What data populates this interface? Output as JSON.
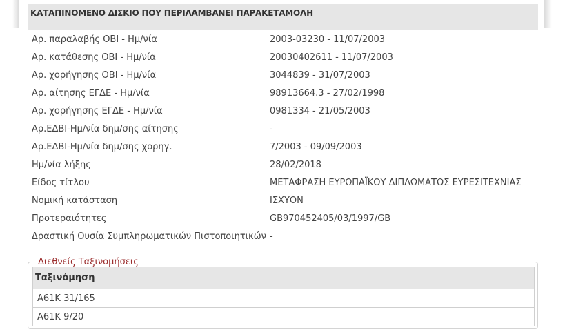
{
  "title": "ΚΑΤΑΠΙΝΟΜΕΝΟ ΔΙΣΚΙΟ ΠΟΥ ΠΕΡΙΛΑΜΒΑΝΕΙ ΠΑΡΑΚΕΤΑΜΟΛΗ",
  "details": [
    {
      "label": "Αρ. παραλαβής ΟΒΙ - Ημ/νία",
      "value": "2003-03230 - 11/07/2003"
    },
    {
      "label": "Αρ. κατάθεσης ΟΒΙ - Ημ/νία",
      "value": "20030402611 - 11/07/2003"
    },
    {
      "label": "Αρ. χορήγησης ΟΒΙ - Ημ/νία",
      "value": "3044839 - 31/07/2003"
    },
    {
      "label": "Αρ. αίτησης ΕΓΔΕ - Ημ/νία",
      "value": "98913664.3 - 27/02/1998"
    },
    {
      "label": "Αρ. χορήγησης ΕΓΔΕ - Ημ/νία",
      "value": "0981334 - 21/05/2003"
    },
    {
      "label": "Αρ.ΕΔΒΙ-Ημ/νία δημ/σης αίτησης",
      "value": "-"
    },
    {
      "label": "Αρ.ΕΔΒΙ-Ημ/νία δημ/σης χορηγ.",
      "value": "7/2003 - 09/09/2003"
    },
    {
      "label": "Ημ/νία λήξης",
      "value": "28/02/2018"
    },
    {
      "label": "Είδος τίτλου",
      "value": "ΜΕΤΑΦΡΑΣΗ ΕΥΡΩΠΑΪΚΟΥ ΔΙΠΛΩΜΑΤΟΣ ΕΥΡΕΣΙΤΕΧΝΙΑΣ"
    },
    {
      "label": "Νομική κατάσταση",
      "value": "ΙΣΧΥΟΝ"
    },
    {
      "label": "Προτεραιότητες",
      "value": "GB970452405/03/1997/GB"
    },
    {
      "label": "Δραστική Ουσία Συμπληρωματικών Πιστοποιητικών",
      "value": "-"
    }
  ],
  "classifications": {
    "legend": "Διεθνείς Ταξινομήσεις",
    "header": "Ταξινόμηση",
    "rows": [
      "A61K 31/165",
      "A61K 9/20"
    ]
  }
}
